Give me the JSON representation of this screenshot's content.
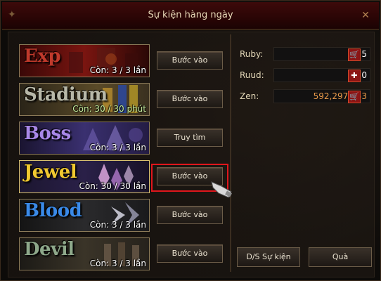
{
  "window": {
    "title": "Sự kiện hàng ngày",
    "close_symbol": "✕"
  },
  "events": [
    {
      "name": "Exp",
      "count": "Còn: 3 / 3 lần",
      "button": "Bước vào",
      "color": "#c0392b"
    },
    {
      "name": "Stadium",
      "count": "Còn: 30 / 30 phút",
      "button": "Bước vào",
      "color": "#b8b8a8"
    },
    {
      "name": "Boss",
      "count": "Còn: 3 / 3 lần",
      "button": "Truy tìm",
      "color": "#a888e8"
    },
    {
      "name": "Jewel",
      "count": "Còn: 30 / 30 lần",
      "button": "Bước vào",
      "color": "#f0c830"
    },
    {
      "name": "Blood",
      "count": "Còn: 3 / 3 lần",
      "button": "Bước vào",
      "color": "#3a8ae8"
    },
    {
      "name": "Devil",
      "count": "Còn: 3 / 3 lần",
      "button": "Bước vào",
      "color": "#8ea88a"
    }
  ],
  "resources": {
    "ruby": {
      "label": "Ruby:",
      "value": "5",
      "action_icon": "cart-icon"
    },
    "ruud": {
      "label": "Ruud:",
      "value": "0",
      "action_icon": "plus-icon"
    },
    "zen": {
      "label": "Zen:",
      "value": "592,297,053",
      "action_icon": "cart-icon"
    }
  },
  "footer": {
    "ranking_label": "D/S Sự kiện",
    "reward_label": "Quà"
  },
  "highlight_color": "#e0161c"
}
